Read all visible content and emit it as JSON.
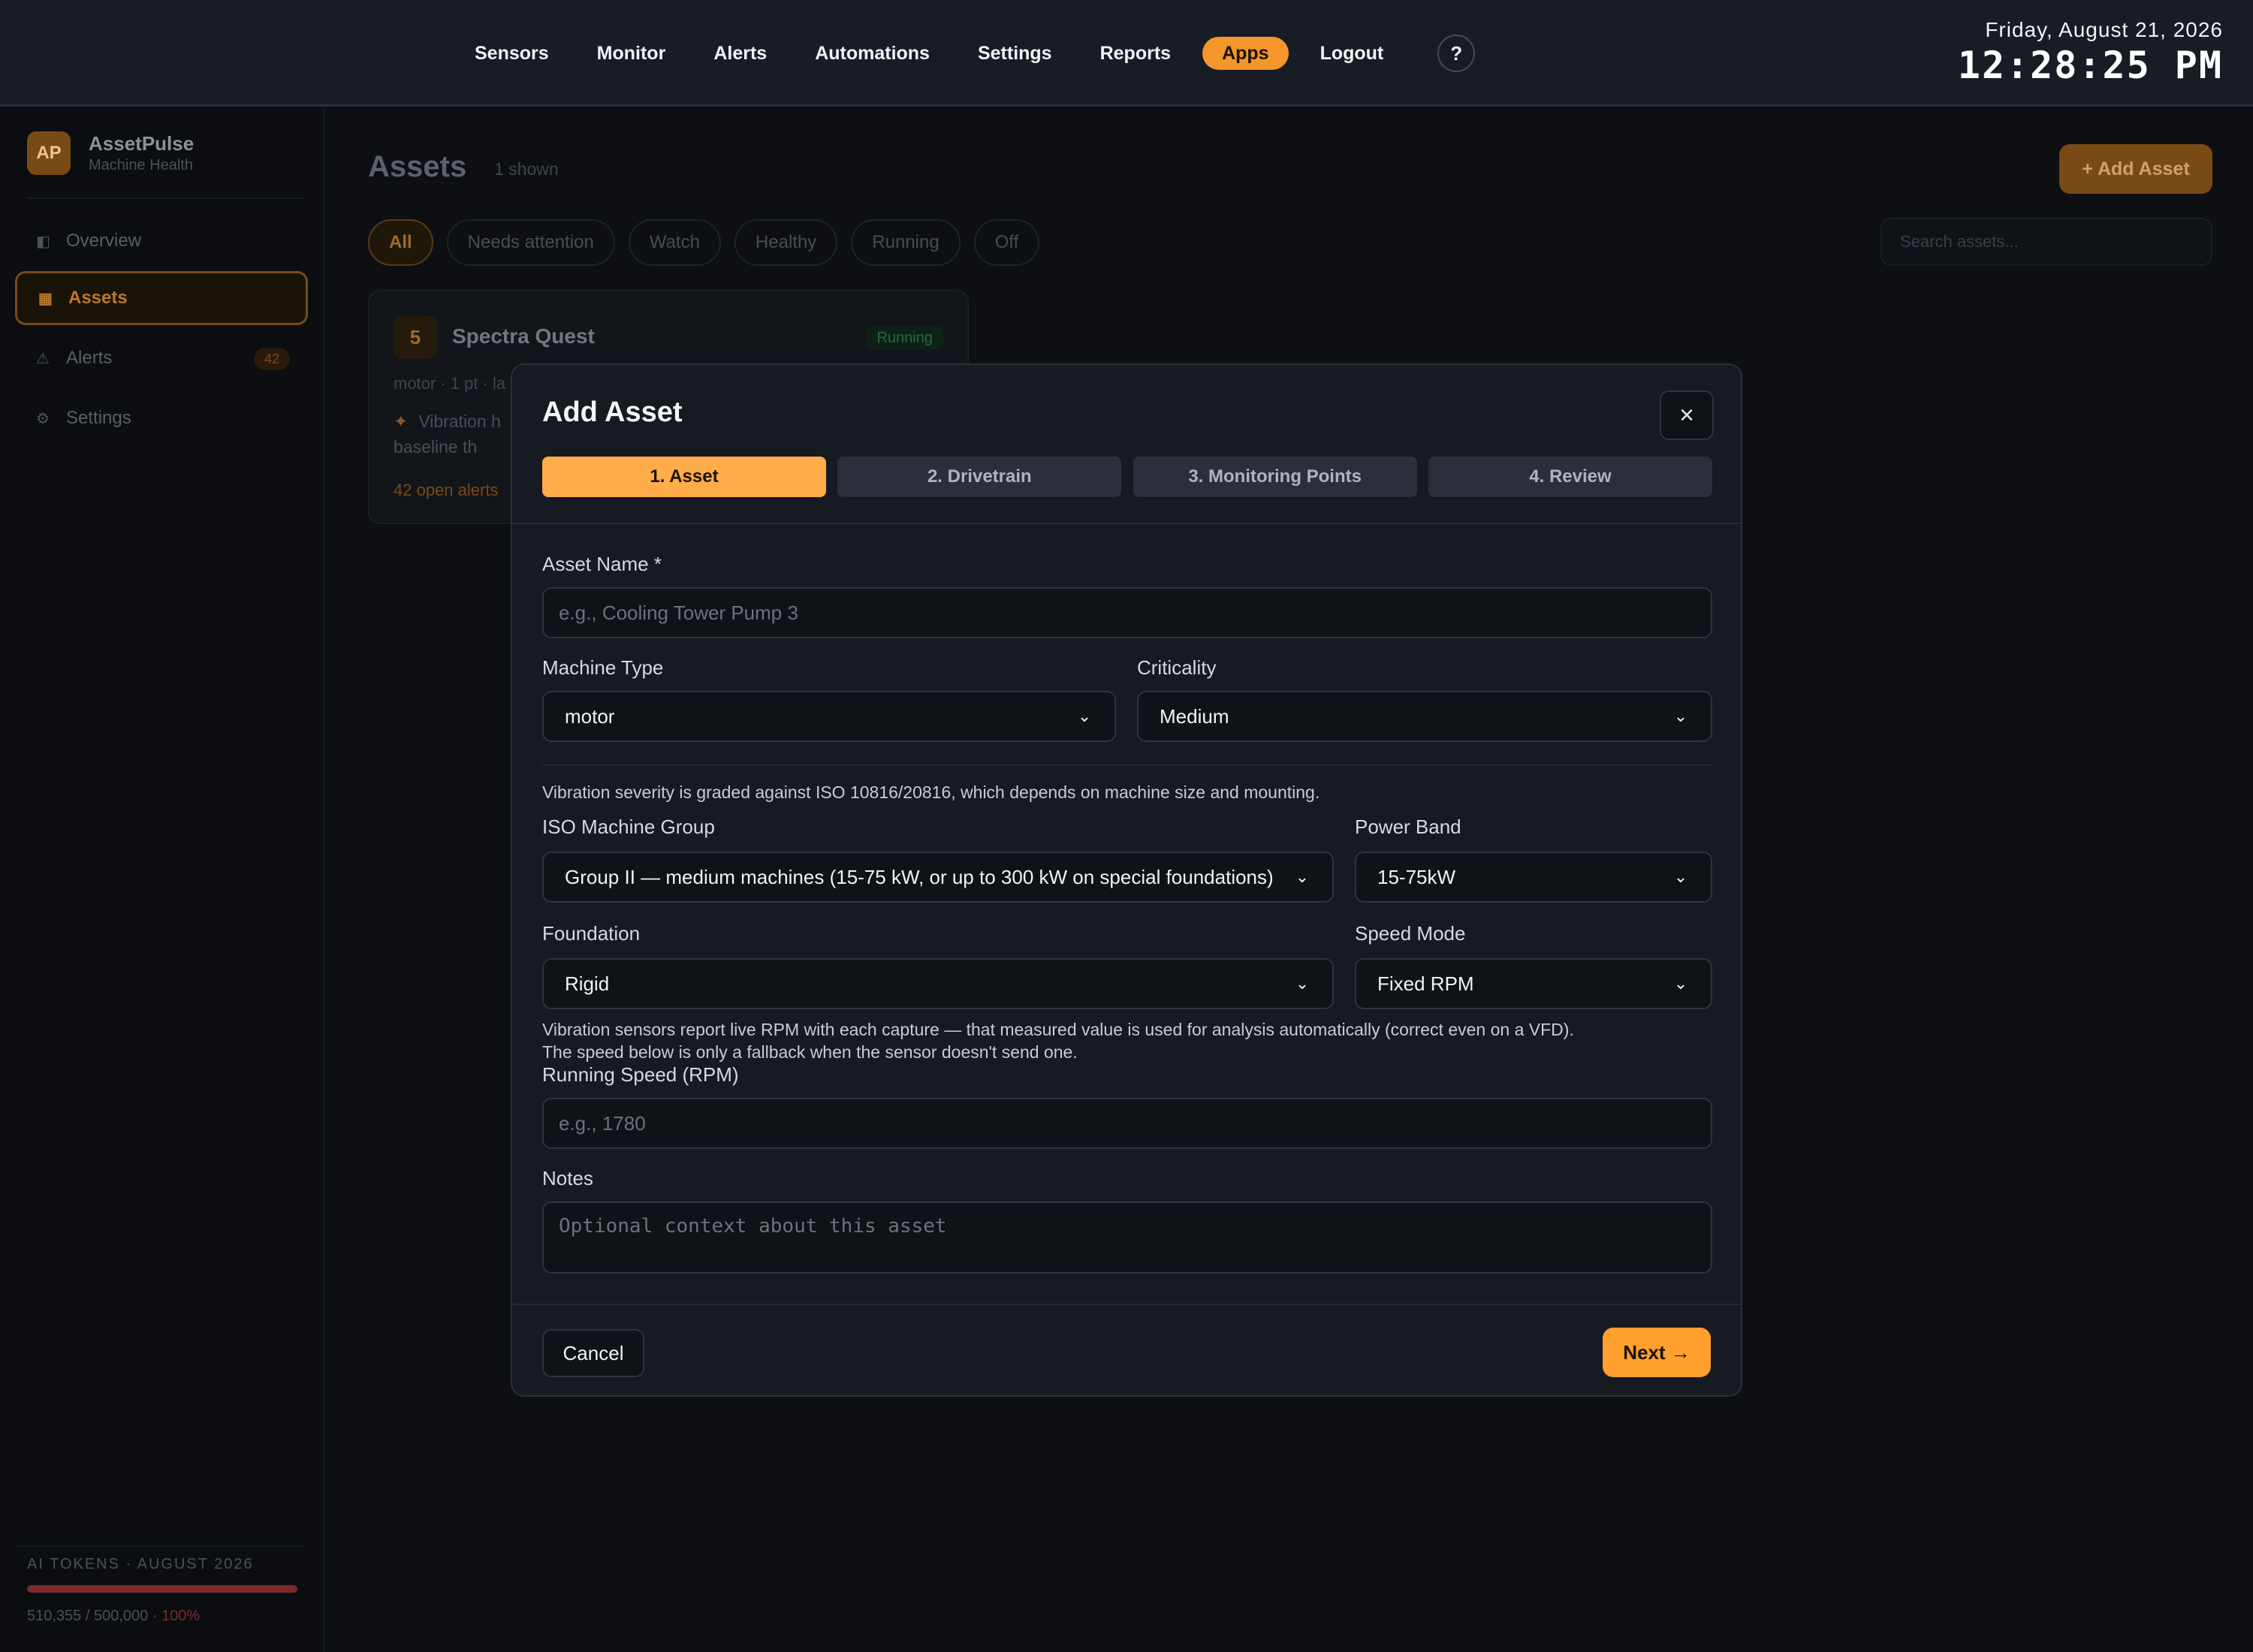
{
  "nav": {
    "items": [
      {
        "label": "Sensors",
        "active": false
      },
      {
        "label": "Monitor",
        "active": false
      },
      {
        "label": "Alerts",
        "active": false
      },
      {
        "label": "Automations",
        "active": false
      },
      {
        "label": "Settings",
        "active": false
      },
      {
        "label": "Reports",
        "active": false
      },
      {
        "label": "Apps",
        "active": true
      },
      {
        "label": "Logout",
        "active": false
      }
    ],
    "help_label": "?",
    "date": "Friday, August 21, 2026",
    "time": "12:28:25 PM",
    "accent_color": "#f5962b"
  },
  "sidebar": {
    "brand_initials": "AP",
    "brand_name": "AssetPulse",
    "brand_subtitle": "Machine Health",
    "items": [
      {
        "icon": "overview-icon",
        "label": "Overview",
        "active": false
      },
      {
        "icon": "assets-icon",
        "label": "Assets",
        "active": true
      },
      {
        "icon": "alert-triangle-icon",
        "label": "Alerts",
        "active": false,
        "badge": "42"
      },
      {
        "icon": "gear-icon",
        "label": "Settings",
        "active": false
      }
    ],
    "tokens": {
      "label": "AI TOKENS · AUGUST 2026",
      "used": "510,355",
      "limit": "500,000",
      "percent": "100%",
      "fill_fraction": 1.0
    }
  },
  "main": {
    "title": "Assets",
    "count": "1 shown",
    "add_button": "+ Add Asset",
    "filters": [
      {
        "label": "All",
        "active": true
      },
      {
        "label": "Needs attention",
        "active": false
      },
      {
        "label": "Watch",
        "active": false
      },
      {
        "label": "Healthy",
        "active": false
      },
      {
        "label": "Running",
        "active": false
      },
      {
        "label": "Off",
        "active": false
      }
    ],
    "search_placeholder": "Search assets...",
    "card": {
      "number": "5",
      "name": "Spectra Quest",
      "status": "Running",
      "meta": "motor · 1 pt · la",
      "insight": "Vibration h baseline th",
      "alerts": "42 open alerts"
    }
  },
  "modal": {
    "title": "Add Asset",
    "close_label": "×",
    "steps": [
      {
        "label": "1. Asset",
        "active": true
      },
      {
        "label": "2. Drivetrain",
        "active": false
      },
      {
        "label": "3. Monitoring Points",
        "active": false
      },
      {
        "label": "4. Review",
        "active": false
      }
    ],
    "asset_name": {
      "label": "Asset Name *",
      "value": "",
      "placeholder": "e.g., Cooling Tower Pump 3"
    },
    "machine_type": {
      "label": "Machine Type",
      "value": "motor"
    },
    "criticality": {
      "label": "Criticality",
      "value": "Medium"
    },
    "iso_hint": "Vibration severity is graded against ISO 10816/20816, which depends on machine size and mounting.",
    "iso_group": {
      "label": "ISO Machine Group",
      "value": "Group II — medium machines (15-75 kW, or up to 300 kW on special foundations)"
    },
    "power_band": {
      "label": "Power Band",
      "value": "15-75kW"
    },
    "foundation": {
      "label": "Foundation",
      "value": "Rigid"
    },
    "speed_mode": {
      "label": "Speed Mode",
      "value": "Fixed RPM"
    },
    "rpm_hint_line1": "Vibration sensors report live RPM with each capture — that measured value is used for analysis automatically (correct even on a VFD).",
    "rpm_hint_line2": "The speed below is only a fallback when the sensor doesn't send one.",
    "running_speed": {
      "label": "Running Speed (RPM)",
      "value": "",
      "placeholder": "e.g., 1780"
    },
    "notes": {
      "label": "Notes",
      "value": "",
      "placeholder": "Optional context about this asset"
    },
    "cancel_label": "Cancel",
    "next_label": "Next →"
  }
}
